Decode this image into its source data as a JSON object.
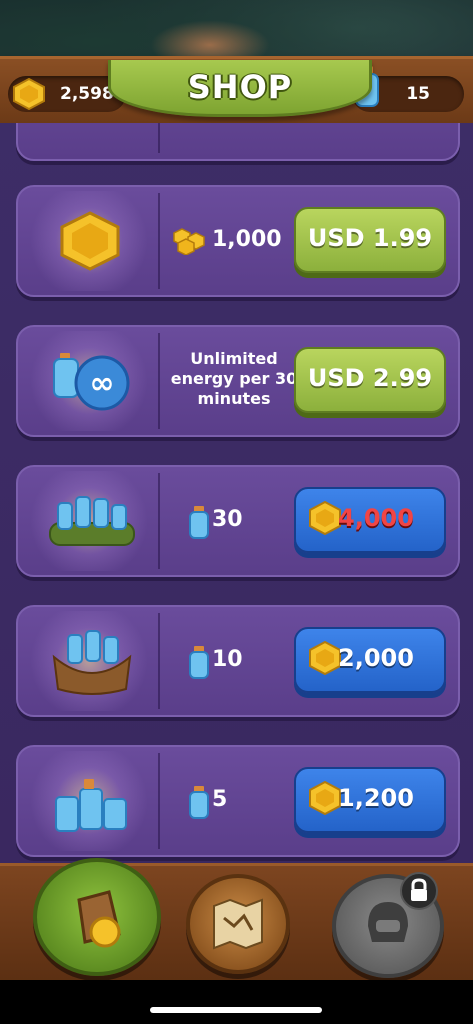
{
  "header": {
    "title": "SHOP",
    "coins": "2,598",
    "energy": "15"
  },
  "shop_items": [
    {
      "mid_value": "1,000",
      "price": "USD 1.99",
      "price_style": "green"
    },
    {
      "mid_desc": "Unlimited energy per 30 minutes",
      "price": "USD 2.99",
      "price_style": "green"
    },
    {
      "mid_value": "30",
      "price": "4,000",
      "price_style": "blue",
      "price_color": "#f04545"
    },
    {
      "mid_value": "10",
      "price": "2,000",
      "price_style": "blue"
    },
    {
      "mid_value": "5",
      "price": "1,200",
      "price_style": "blue"
    }
  ],
  "bottom_nav": [
    {
      "name": "shop",
      "icon": "coin-bag-icon",
      "active": true
    },
    {
      "name": "map",
      "icon": "treasure-map-icon",
      "active": false
    },
    {
      "name": "locked",
      "icon": "helmet-icon",
      "locked": true
    }
  ],
  "colors": {
    "accent_green": "#8cb03c",
    "accent_blue": "#2463c9",
    "card_purple": "#5a3e8a",
    "coin_gold": "#f5c22a"
  }
}
